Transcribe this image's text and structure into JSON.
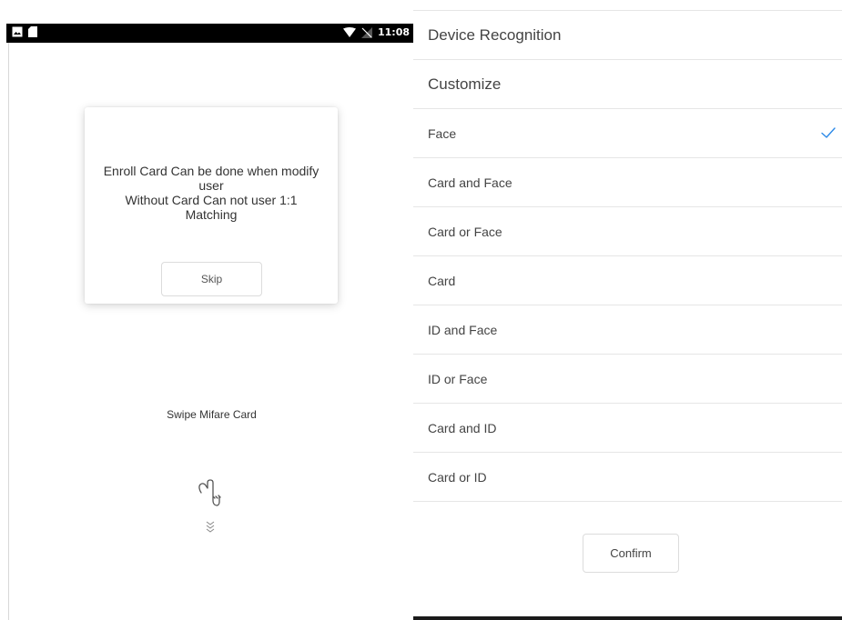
{
  "status_bar": {
    "time": "11:08",
    "left_icons": [
      "image-icon",
      "sd-card-icon"
    ],
    "right_icons": [
      "wifi-icon",
      "no-signal-icon"
    ]
  },
  "dialog": {
    "message": "Enroll Card Can be done when modify\nuser\nWithout Card Can not user 1:1\nMatching",
    "skip_label": "Skip"
  },
  "card_prompt": {
    "label": "Swipe Mifare Card",
    "icons": [
      "hand-point-down-icon",
      "chevrons-down-icon"
    ]
  },
  "menu": {
    "headers": [
      {
        "label": "Device Recognition"
      },
      {
        "label": "Customize"
      }
    ],
    "options": [
      {
        "label": "Face",
        "selected": true
      },
      {
        "label": "Card and Face",
        "selected": false
      },
      {
        "label": "Card or Face",
        "selected": false
      },
      {
        "label": "Card",
        "selected": false
      },
      {
        "label": "ID and Face",
        "selected": false
      },
      {
        "label": "ID or Face",
        "selected": false
      },
      {
        "label": "Card and ID",
        "selected": false
      },
      {
        "label": "Card or ID",
        "selected": false
      }
    ],
    "confirm_label": "Confirm"
  },
  "colors": {
    "accent": "#2d8ae8",
    "divider": "#e6e6e6",
    "status_bar": "#000000"
  }
}
